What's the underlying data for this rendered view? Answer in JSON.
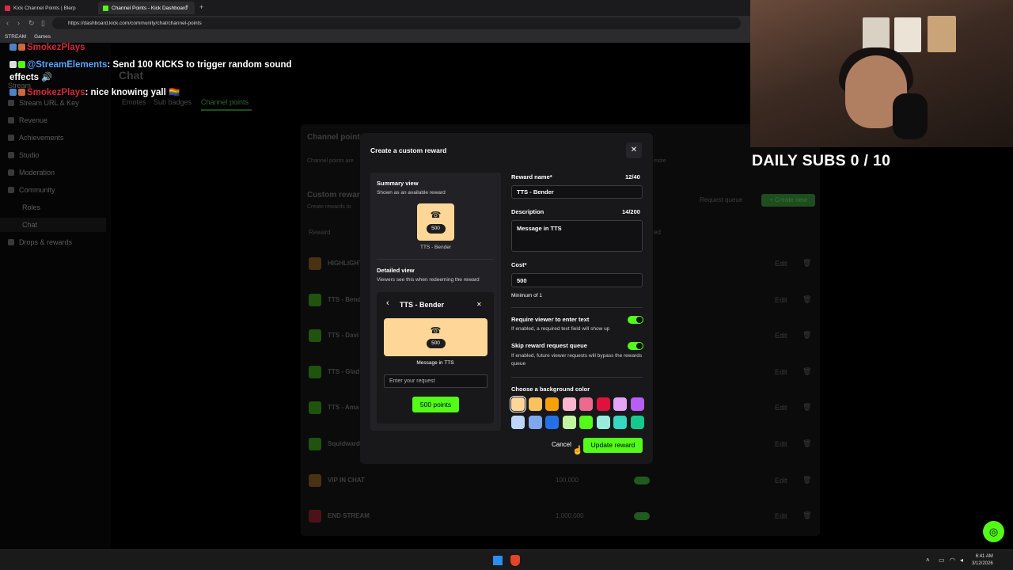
{
  "browser": {
    "tabs": [
      {
        "label": "Kick Channel Points | Blerp"
      },
      {
        "label": "Channel Points - Kick Dashboard"
      }
    ],
    "tab_close_glyph": "×",
    "new_tab_glyph": "+",
    "url": "https://dashboard.kick.com/community/chat/channel-points",
    "bookmarks": [
      "STREAM",
      "Games"
    ]
  },
  "chat_overlay": {
    "messages": [
      {
        "user": "SmokezPlays",
        "text": ""
      },
      {
        "user": "@StreamElements",
        "text": ": Send 100 KICKS to trigger random sound effects 🔊"
      },
      {
        "user": "SmokezPlays",
        "text": ": nice knowing yall 🏳️‍🌈"
      }
    ]
  },
  "dashboard": {
    "page_title": "Chat",
    "sidebar": {
      "items": [
        "Stream",
        "Stream URL & Key",
        "Revenue",
        "Achievements",
        "Studio",
        "Moderation",
        "Community",
        "Roles",
        "Chat",
        "Drops & rewards"
      ]
    },
    "tabs": [
      "Emotes",
      "Sub badges",
      "Channel points"
    ],
    "panel": {
      "title": "Channel points",
      "subtitle": "Channel points are",
      "learn_more": "more",
      "custom_rewards_title": "Custom rewards",
      "custom_rewards_subtitle": "Create rewards to",
      "request_queue": "Request queue",
      "create_new": "+ Create new",
      "col_reward": "Reward",
      "col_enabled": "ed",
      "rows": [
        {
          "name": "HIGHLIGHT",
          "cost": "",
          "color": "#d98b2a"
        },
        {
          "name": "TTS - Bend",
          "cost": "",
          "color": "#53fc18"
        },
        {
          "name": "TTS - Davi",
          "cost": "",
          "color": "#53fc18"
        },
        {
          "name": "TTS - Glad",
          "cost": "",
          "color": "#53fc18"
        },
        {
          "name": "TTS - Ama",
          "cost": "",
          "color": "#53fc18"
        },
        {
          "name": "Squidward",
          "cost": "",
          "color": "#53fc18"
        },
        {
          "name": "VIP IN CHAT",
          "cost": "100,000",
          "color": "#d98b2a"
        },
        {
          "name": "END STREAM",
          "cost": "1,000,000",
          "color": "#e0293a"
        }
      ],
      "edit_label": "Edit"
    }
  },
  "modal": {
    "title": "Create a custom reward",
    "close_glyph": "✕",
    "summary": {
      "heading": "Summary view",
      "sub": "Shown as an available reward",
      "cost": "500",
      "name": "TTS - Bender"
    },
    "detailed": {
      "heading": "Detailed view",
      "sub": "Viewers see this when redeeming the reward",
      "back_glyph": "‹",
      "title": "TTS - Bender",
      "close_glyph": "✕",
      "cost": "500",
      "description": "Message in TTS",
      "request_placeholder": "Enter your request",
      "points_button": "500 points"
    },
    "form": {
      "name_label": "Reward name*",
      "name_count": "12/40",
      "name_value": "TTS - Bender",
      "desc_label": "Description",
      "desc_count": "14/200",
      "desc_value": "Message in TTS",
      "cost_label": "Cost*",
      "cost_value": "500",
      "cost_hint": "Minimum of 1",
      "require_label": "Require viewer to enter text",
      "require_hint": "If enabled, a required text field will show up",
      "require_on": true,
      "skip_label": "Skip reward request queue",
      "skip_hint": "If enabled, future viewer requests will bypass the rewards queue",
      "skip_on": true,
      "color_label": "Choose a background color",
      "colors": [
        "#fed798",
        "#fbc15c",
        "#f59f0b",
        "#fbb6ce",
        "#ec6a8f",
        "#e0113d",
        "#e3a3f7",
        "#b85ef5",
        "#bcd6fb",
        "#7fa8ec",
        "#2471e6",
        "#c2f5a0",
        "#53fc18",
        "#99ebdd",
        "#37d6c0",
        "#14c98b"
      ],
      "selected_color": "#fed798"
    },
    "cancel": "Cancel",
    "submit": "Update reward"
  },
  "stream_overlay": {
    "daily_subs": "DAILY SUBS 0 / 10"
  },
  "taskbar": {
    "time": "6:41 AM",
    "date": "3/12/2026"
  }
}
